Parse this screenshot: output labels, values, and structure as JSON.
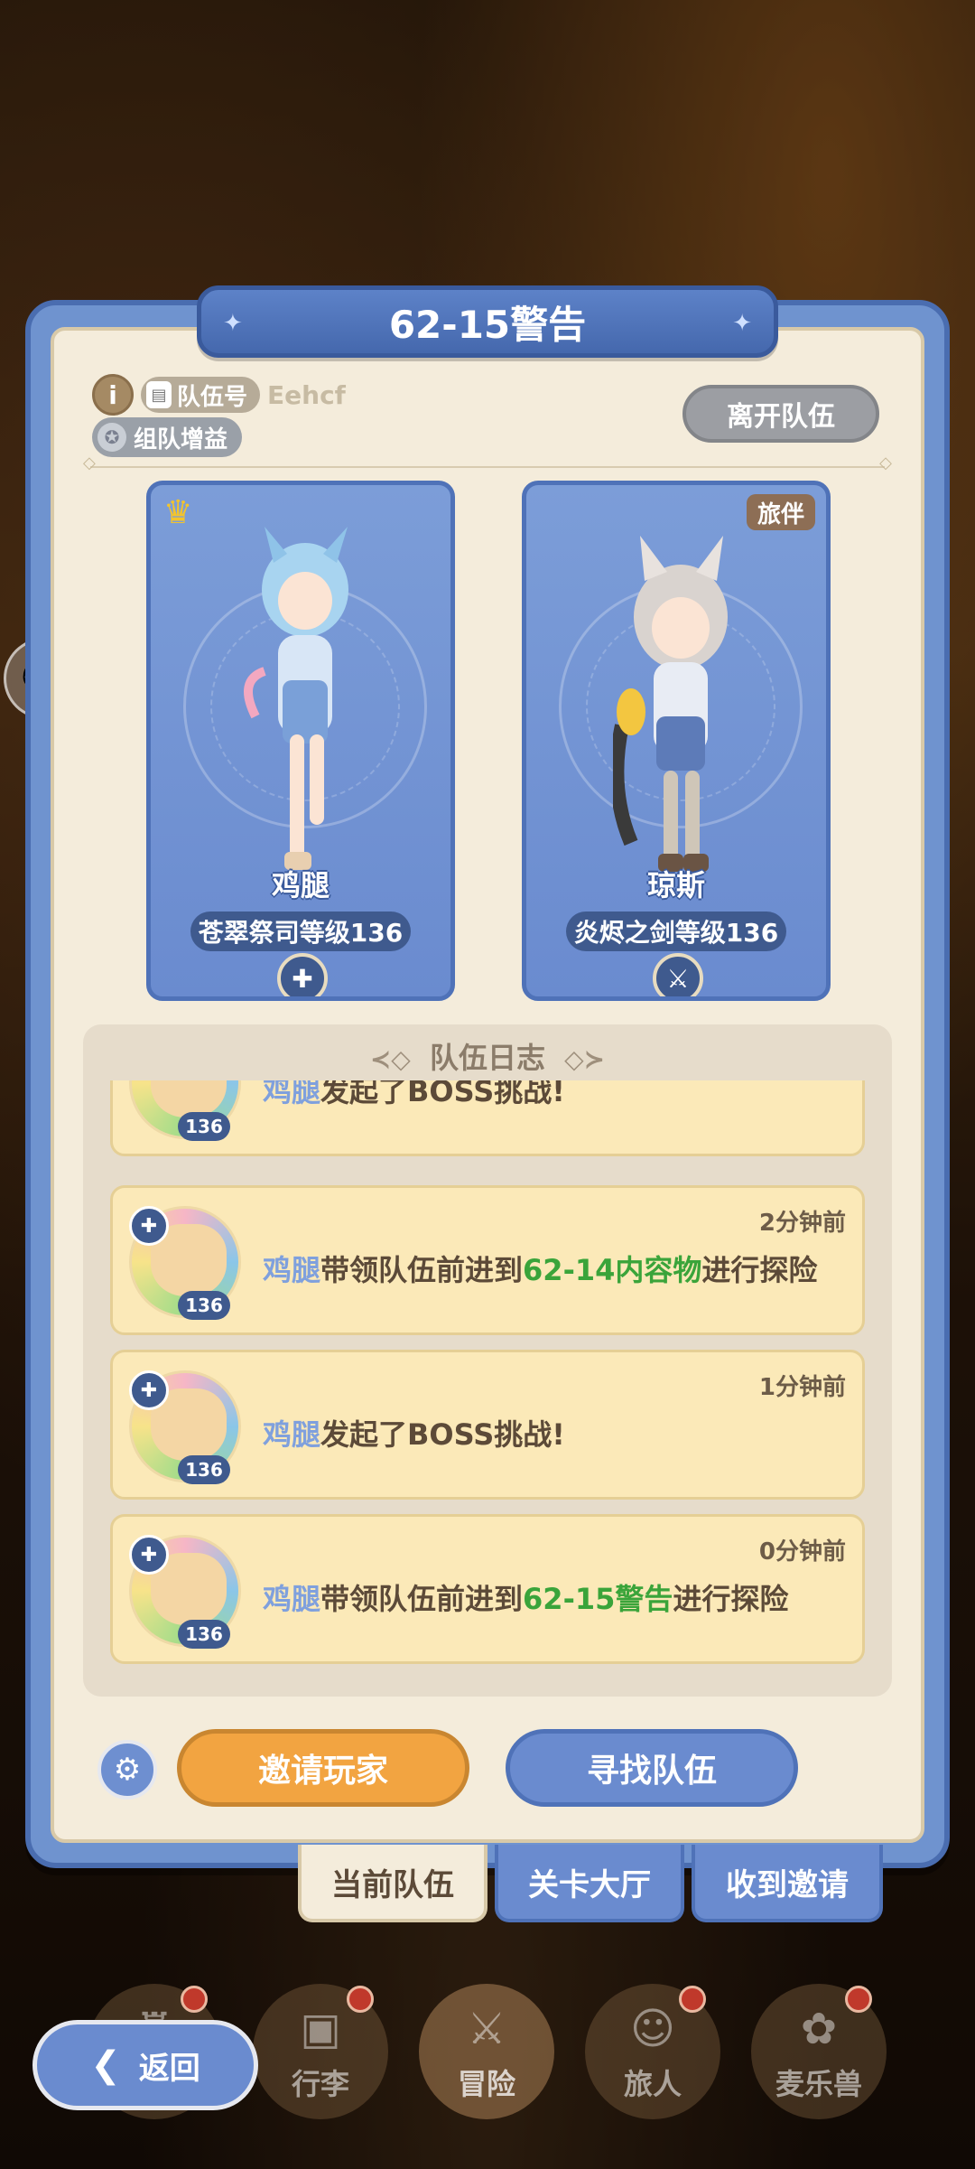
{
  "header": {
    "title": "62-15警告",
    "info_icon": "i",
    "team_id_label": "队伍号",
    "team_code": "Eehcf",
    "buff_label": "组队增益",
    "leave_label": "离开队伍"
  },
  "members": [
    {
      "name": "鸡腿",
      "level_text": "苍翠祭司等级136",
      "crown": "♛",
      "class_icon": "cross-shield-icon"
    },
    {
      "name": "琼斯",
      "level_text": "炎烬之剑等级136",
      "tag": "旅伴",
      "class_icon": "sword-icon"
    }
  ],
  "log": {
    "title": "队伍日志",
    "items": [
      {
        "time": "",
        "who": "鸡腿",
        "pre": "",
        "action": "发起了BOSS挑战!",
        "place": "",
        "post": "",
        "level": "136"
      },
      {
        "time": "2分钟前",
        "who": "鸡腿",
        "action": "带领队伍前进到",
        "place": "62-14内容物",
        "post": "进行探险",
        "level": "136"
      },
      {
        "time": "1分钟前",
        "who": "鸡腿",
        "action": "发起了BOSS挑战!",
        "place": "",
        "post": "",
        "level": "136"
      },
      {
        "time": "0分钟前",
        "who": "鸡腿",
        "action": "带领队伍前进到",
        "place": "62-15警告",
        "post": "进行探险",
        "level": "136"
      }
    ]
  },
  "actions": {
    "invite_label": "邀请玩家",
    "find_label": "寻找队伍"
  },
  "tabs": [
    {
      "label": "当前队伍",
      "active": true
    },
    {
      "label": "关卡大厅",
      "active": false
    },
    {
      "label": "收到邀请",
      "active": false
    }
  ],
  "nav": {
    "back_label": "返回",
    "items": [
      {
        "label": "",
        "icon": "castle-icon"
      },
      {
        "label": "行李",
        "icon": "bag-icon"
      },
      {
        "label": "冒险",
        "icon": "crossed-swords-icon"
      },
      {
        "label": "旅人",
        "icon": "traveler-icon"
      },
      {
        "label": "麦乐兽",
        "icon": "pet-icon"
      }
    ]
  },
  "colors": {
    "panel_blue": "#6f93cf",
    "cream": "#f4ecdb",
    "log_card": "#fbe9b8",
    "invite_orange": "#f2a441",
    "place_green": "#3aa43a",
    "name_blue": "#7fa0dd"
  }
}
